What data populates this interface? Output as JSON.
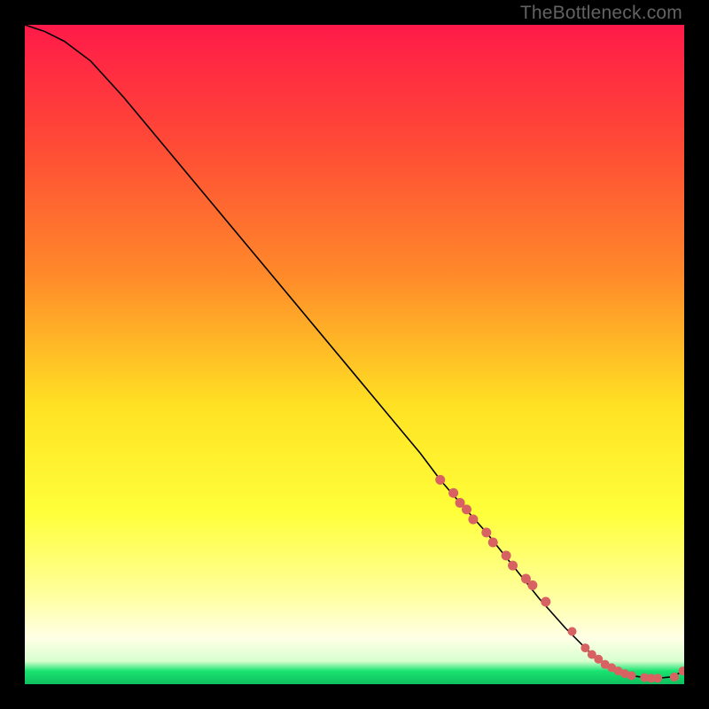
{
  "watermark": "TheBottleneck.com",
  "colors": {
    "gradient_top": "#ff1a49",
    "gradient_upper_mid": "#ff6a2a",
    "gradient_mid": "#ffe223",
    "gradient_lower_mid": "#ffff66",
    "gradient_pale": "#ffffe0",
    "gradient_green": "#19e370",
    "curve": "#000000",
    "dot": "#d86262",
    "frame": "#000000"
  },
  "chart_data": {
    "type": "line",
    "title": "",
    "xlabel": "",
    "ylabel": "",
    "xlim": [
      0,
      100
    ],
    "ylim": [
      0,
      100
    ],
    "grid": false,
    "legend": false,
    "series": [
      {
        "name": "bottleneck-curve",
        "x": [
          0,
          3,
          6,
          10,
          15,
          20,
          25,
          30,
          35,
          40,
          45,
          50,
          55,
          60,
          63,
          66,
          70,
          74,
          78,
          82,
          86,
          88,
          90,
          92,
          94,
          96,
          98,
          100
        ],
        "y": [
          100,
          99,
          97.5,
          94.5,
          89,
          83,
          77,
          71,
          65,
          59,
          53,
          47,
          41,
          35,
          31,
          27.5,
          23,
          18,
          13,
          8.5,
          4.5,
          3,
          2,
          1.3,
          1,
          0.9,
          1.1,
          2
        ]
      }
    ],
    "points_overlay": {
      "name": "sample-dots",
      "x": [
        63,
        65,
        66,
        67,
        68,
        70,
        71,
        73,
        74,
        76,
        77,
        79,
        83,
        85,
        86,
        87,
        88,
        89,
        90,
        91,
        92,
        94,
        95,
        96,
        98.5,
        99.8
      ],
      "y": [
        31,
        29,
        27.5,
        26.5,
        25,
        23,
        21.5,
        19.5,
        18,
        16,
        15,
        12.5,
        8,
        5.5,
        4.5,
        3.8,
        3,
        2.5,
        2,
        1.6,
        1.3,
        1,
        0.9,
        0.9,
        1.1,
        2
      ]
    }
  }
}
